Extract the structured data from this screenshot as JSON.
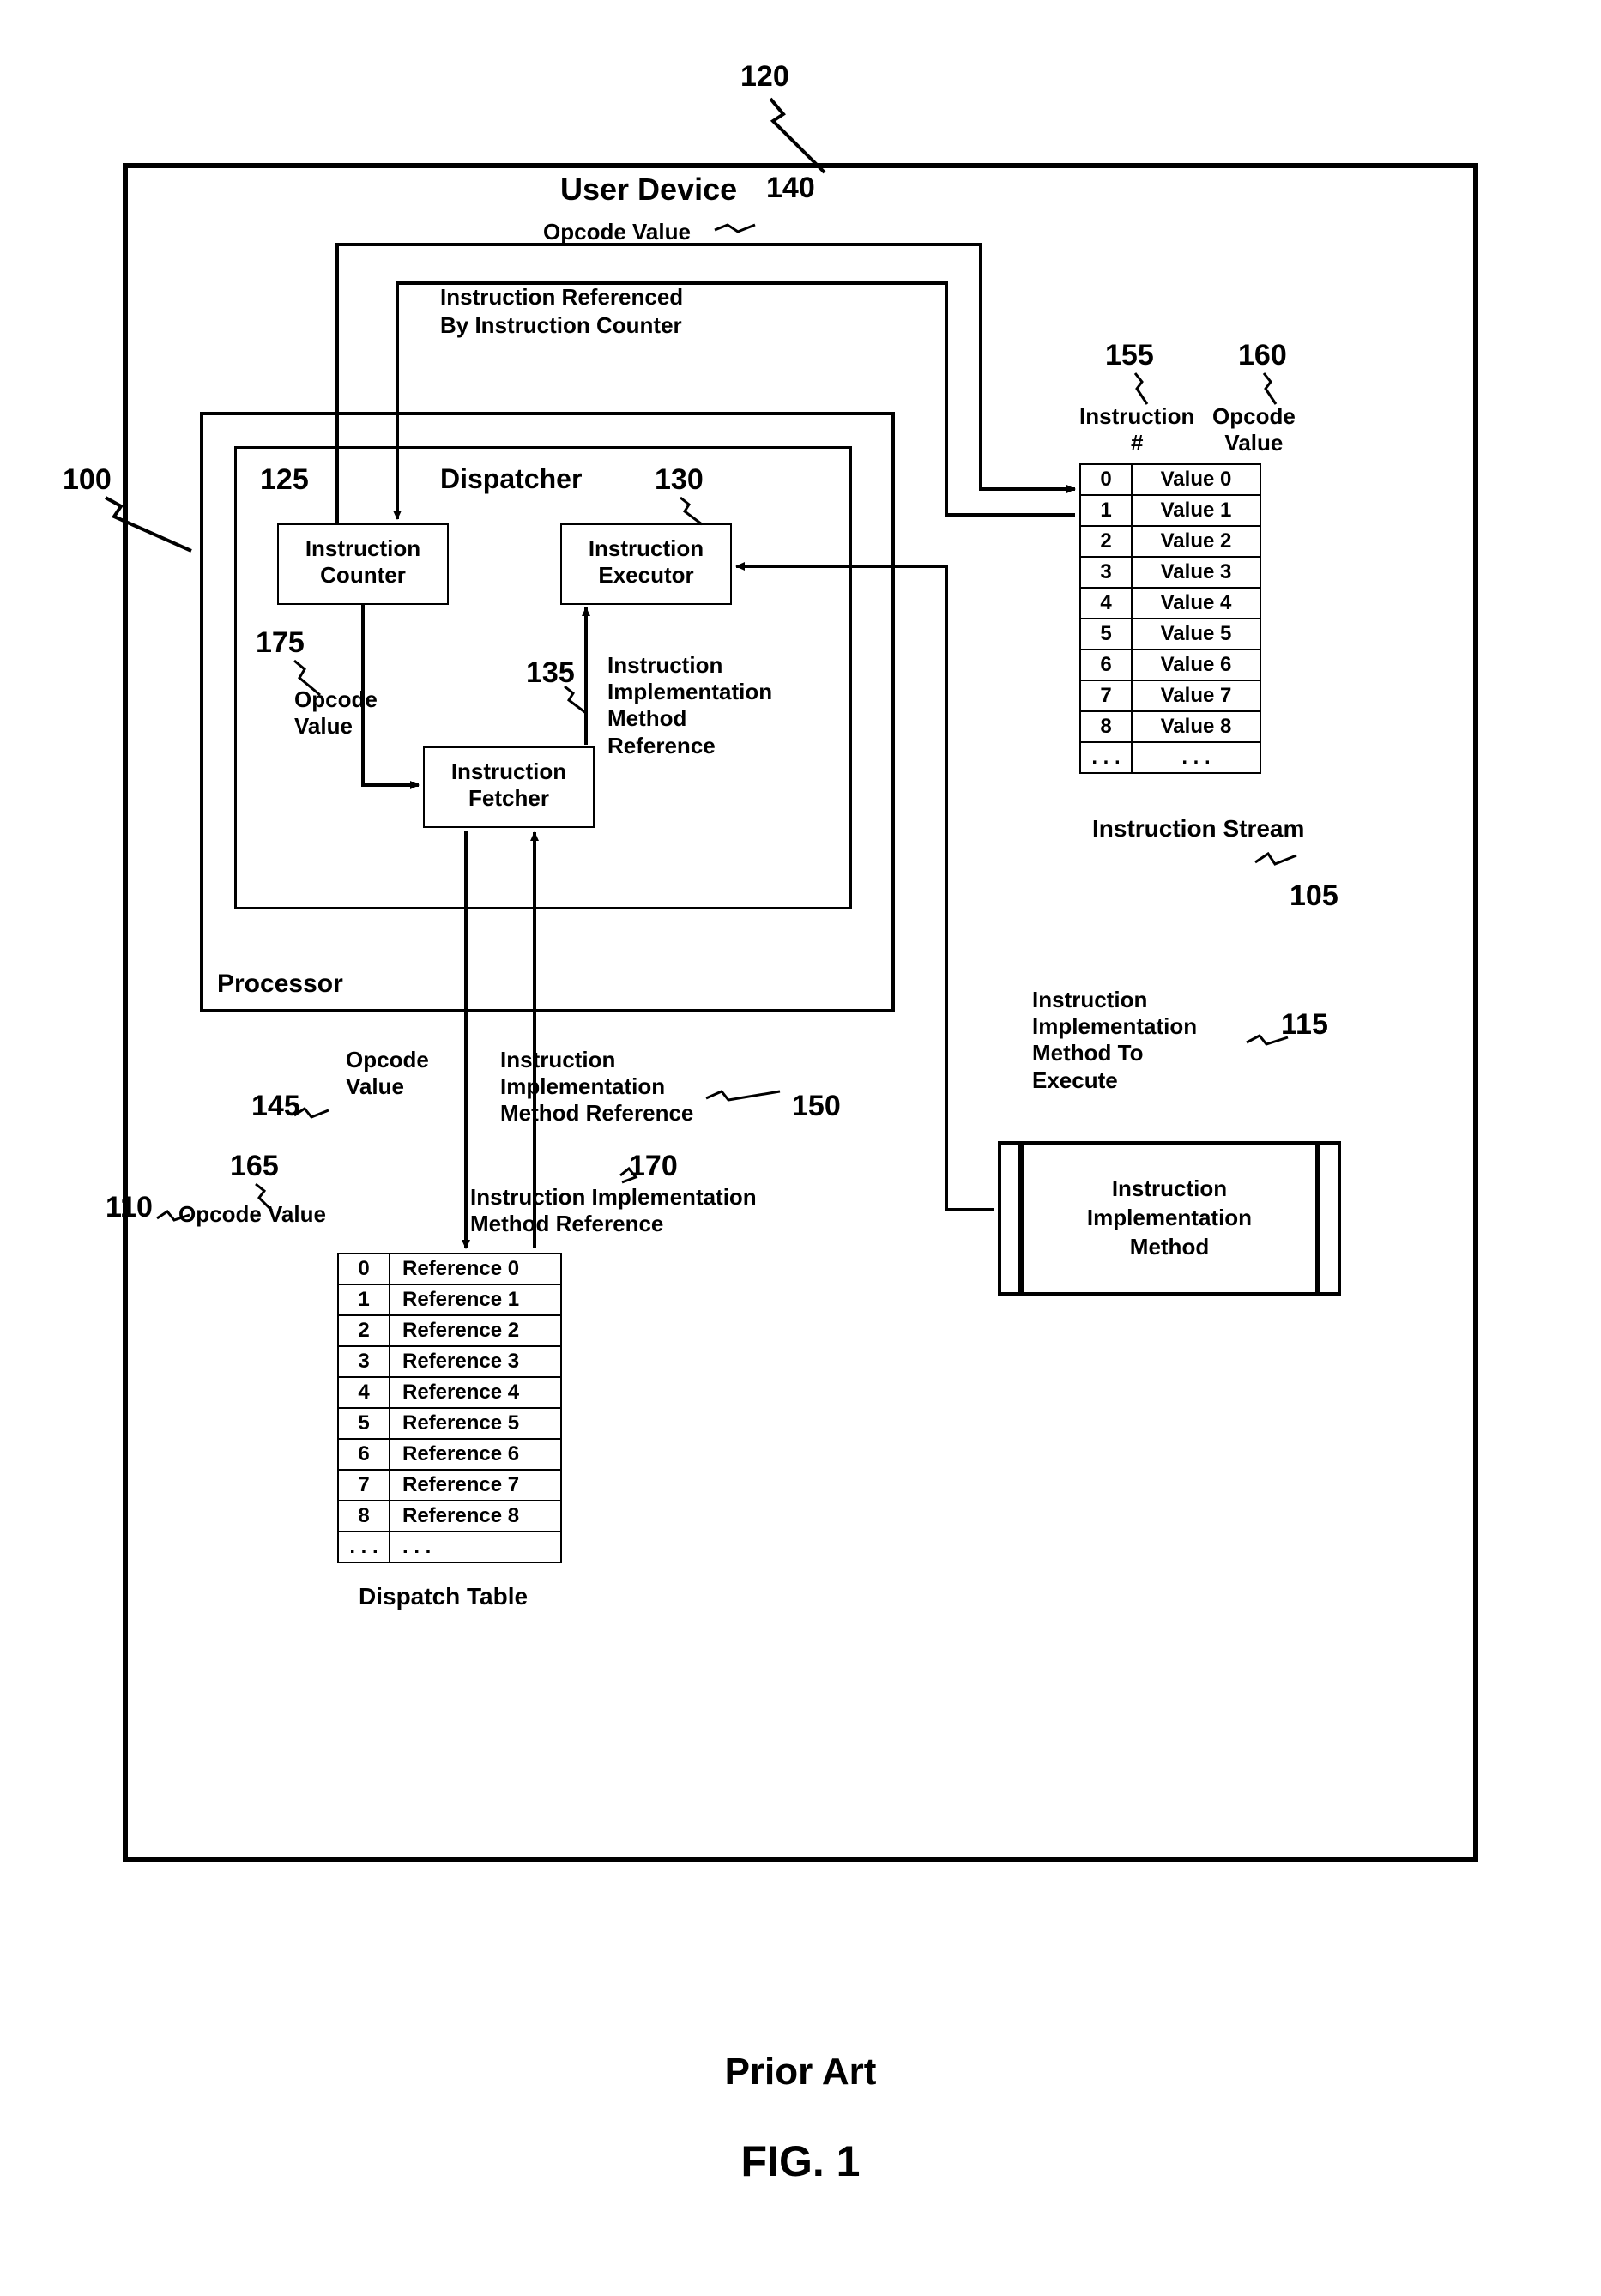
{
  "fig_caption_1": "Prior Art",
  "fig_caption_2": "FIG. 1",
  "refs": {
    "r120": "120",
    "r100": "100",
    "r125": "125",
    "r130": "130",
    "r135": "135",
    "r175": "175",
    "r140": "140",
    "r155": "155",
    "r160": "160",
    "r105": "105",
    "r115": "115",
    "r145": "145",
    "r150": "150",
    "r165": "165",
    "r110": "110",
    "r170": "170"
  },
  "labels": {
    "user_device": "User Device",
    "dispatcher": "Dispatcher",
    "processor": "Processor",
    "instr_counter": "Instruction\nCounter",
    "instr_executor": "Instruction\nExecutor",
    "instr_fetcher": "Instruction\nFetcher",
    "opcode_value_140": "Opcode Value",
    "instr_ref_by_counter": "Instruction Referenced\nBy Instruction Counter",
    "opcode_value_175": "Opcode\nValue",
    "instr_impl_method_ref_135": "Instruction\nImplementation\nMethod\nReference",
    "opcode_value_145": "Opcode\nValue",
    "instr_impl_method_ref_150": "Instruction\nImplementation\nMethod Reference",
    "opcode_value_165": "Opcode Value",
    "instr_impl_method_ref_170": "Instruction Implementation\nMethod Reference",
    "instr_stream": "Instruction Stream",
    "instr_impl_method_exec": "Instruction\nImplementation\nMethod To\nExecute",
    "iim_box": "Instruction\nImplementation\nMethod",
    "dispatch_table": "Dispatch Table",
    "instr_header": "Instruction\n#",
    "opcode_header": "Opcode\nValue"
  },
  "instruction_stream": {
    "headers": [
      "Instruction #",
      "Opcode Value"
    ],
    "rows": [
      [
        "0",
        "Value 0"
      ],
      [
        "1",
        "Value 1"
      ],
      [
        "2",
        "Value 2"
      ],
      [
        "3",
        "Value 3"
      ],
      [
        "4",
        "Value 4"
      ],
      [
        "5",
        "Value 5"
      ],
      [
        "6",
        "Value 6"
      ],
      [
        "7",
        "Value 7"
      ],
      [
        "8",
        "Value 8"
      ],
      [
        ". . .",
        ". . ."
      ]
    ]
  },
  "dispatch_table": {
    "rows": [
      [
        "0",
        "Reference 0"
      ],
      [
        "1",
        "Reference 1"
      ],
      [
        "2",
        "Reference 2"
      ],
      [
        "3",
        "Reference 3"
      ],
      [
        "4",
        "Reference 4"
      ],
      [
        "5",
        "Reference 5"
      ],
      [
        "6",
        "Reference 6"
      ],
      [
        "7",
        "Reference 7"
      ],
      [
        "8",
        "Reference 8"
      ],
      [
        ". . .",
        ". . ."
      ]
    ]
  }
}
